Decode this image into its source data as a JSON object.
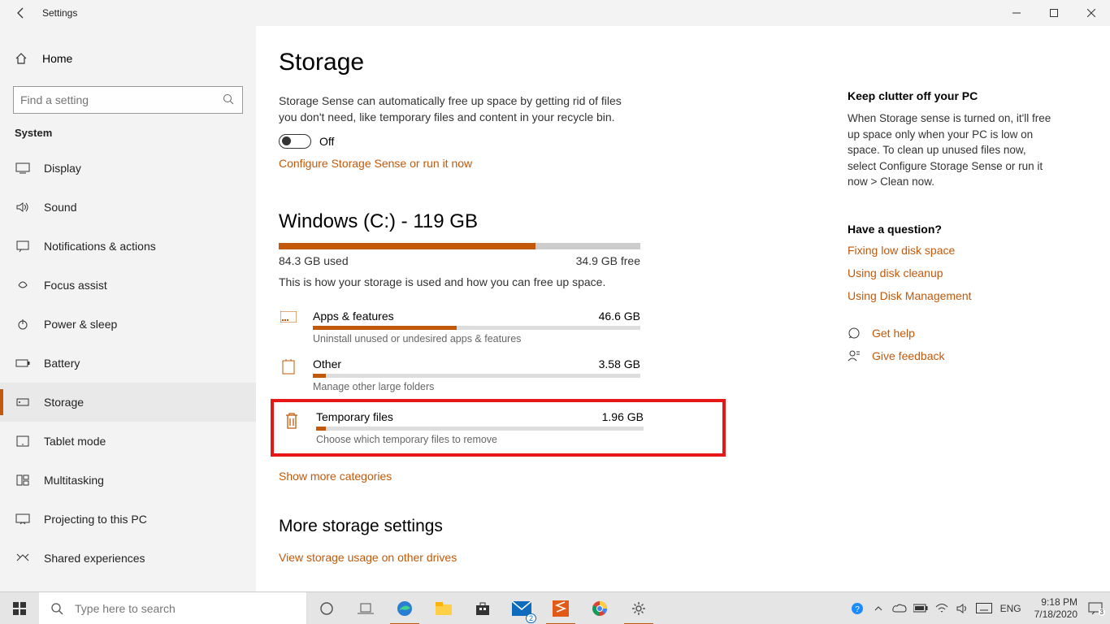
{
  "titlebar": {
    "title": "Settings"
  },
  "sidebar": {
    "home": "Home",
    "search_placeholder": "Find a setting",
    "section": "System",
    "items": [
      {
        "label": "Display"
      },
      {
        "label": "Sound"
      },
      {
        "label": "Notifications & actions"
      },
      {
        "label": "Focus assist"
      },
      {
        "label": "Power & sleep"
      },
      {
        "label": "Battery"
      },
      {
        "label": "Storage"
      },
      {
        "label": "Tablet mode"
      },
      {
        "label": "Multitasking"
      },
      {
        "label": "Projecting to this PC"
      },
      {
        "label": "Shared experiences"
      }
    ]
  },
  "main": {
    "title": "Storage",
    "sense_desc": "Storage Sense can automatically free up space by getting rid of files you don't need, like temporary files and content in your recycle bin.",
    "toggle_label": "Off",
    "configure_link": "Configure Storage Sense or run it now",
    "drive_title": "Windows (C:) - 119 GB",
    "drive_used": "84.3 GB used",
    "drive_free": "34.9 GB free",
    "drive_fill_pct": 71,
    "usage_desc": "This is how your storage is used and how you can free up space.",
    "categories": [
      {
        "name": "Apps & features",
        "size": "46.6 GB",
        "desc": "Uninstall unused or undesired apps & features",
        "fill_pct": 44
      },
      {
        "name": "Other",
        "size": "3.58 GB",
        "desc": "Manage other large folders",
        "fill_pct": 4
      },
      {
        "name": "Temporary files",
        "size": "1.96 GB",
        "desc": "Choose which temporary files to remove",
        "fill_pct": 3
      }
    ],
    "show_more": "Show more categories",
    "more_heading": "More storage settings",
    "more_link": "View storage usage on other drives"
  },
  "rightcol": {
    "tip_h": "Keep clutter off your PC",
    "tip_p": "When Storage sense is turned on, it'll free up space only when your PC is low on space. To clean up unused files now, select Configure Storage Sense or run it now > Clean now.",
    "q_h": "Have a question?",
    "q_links": [
      "Fixing low disk space",
      "Using disk cleanup",
      "Using Disk Management"
    ],
    "help": "Get help",
    "feedback": "Give feedback"
  },
  "taskbar": {
    "search": "Type here to search",
    "lang": "ENG",
    "time": "9:18 PM",
    "date": "7/18/2020",
    "mail_badge": "2",
    "notif_badge": "3"
  },
  "colors": {
    "accent": "#c2590a"
  }
}
